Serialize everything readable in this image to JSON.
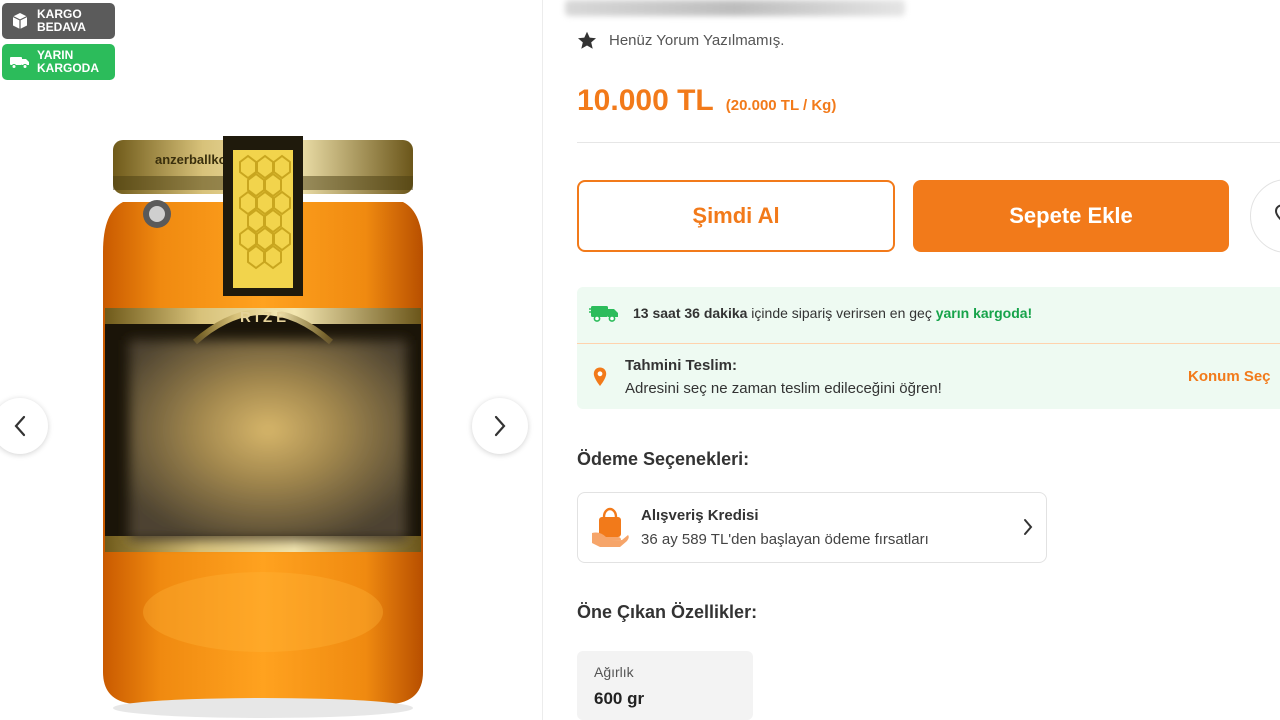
{
  "badges": {
    "free_shipping": "KARGO BEDAVA",
    "tomorrow_shipping": "YARIN KARGODA"
  },
  "product": {
    "jar_cap_text": "anzerballkooperatif",
    "label_text": "RİZE",
    "review_text": "Henüz Yorum Yazılmamış.",
    "price": "10.000 TL",
    "unit_price": "(20.000 TL / Kg)"
  },
  "actions": {
    "buy_now": "Şimdi Al",
    "add_to_cart": "Sepete Ekle"
  },
  "delivery": {
    "countdown": "13 saat 36 dakika",
    "countdown_middle": " içinde sipariş verirsen en geç ",
    "countdown_highlight": "yarın kargoda!",
    "estimate_title": "Tahmini Teslim:",
    "estimate_subtitle": "Adresini seç ne zaman teslim edileceğini öğren!",
    "location_action": "Konum Seç"
  },
  "payment": {
    "section_title": "Ödeme Seçenekleri:",
    "card_title": "Alışveriş Kredisi",
    "card_subtitle": "36 ay 589 TL'den başlayan ödeme fırsatları"
  },
  "features": {
    "section_title": "Öne Çıkan Özellikler:",
    "items": [
      {
        "label": "Ağırlık",
        "value": "600 gr"
      }
    ]
  },
  "colors": {
    "accent": "#f27a1a",
    "success": "#16a34a",
    "badge_gray": "#5b5b5b",
    "badge_green": "#2cbc5b",
    "delivery_bg": "#eefaf2"
  }
}
